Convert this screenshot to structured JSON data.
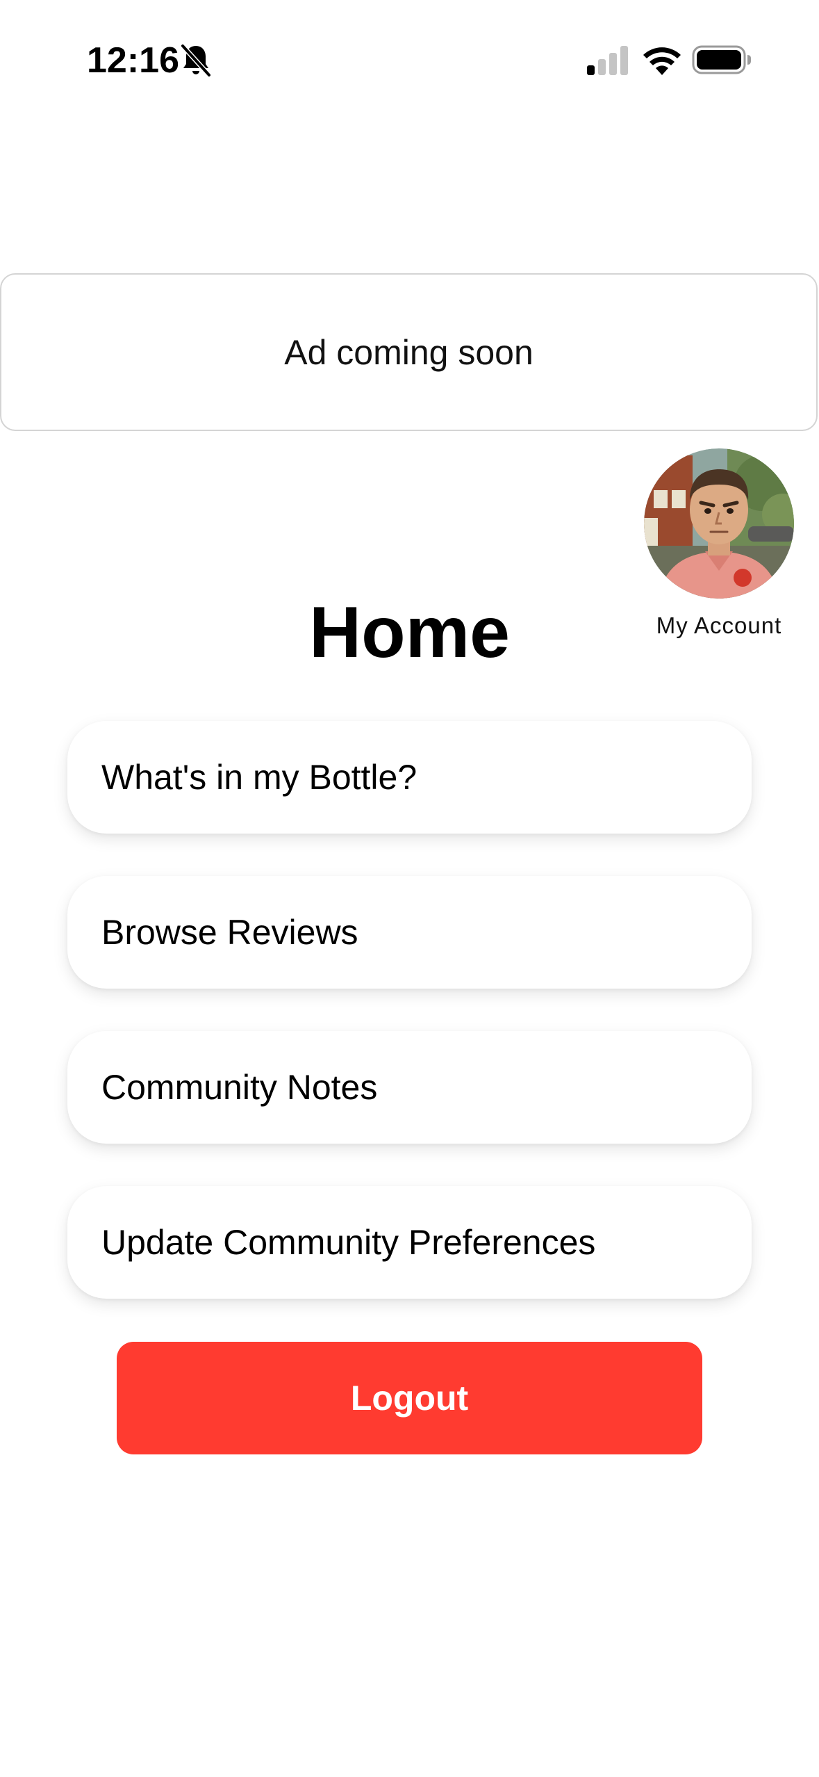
{
  "status_bar": {
    "time": "12:16",
    "icons": [
      "bell-slash-icon",
      "cellular-signal-icon",
      "wifi-icon",
      "battery-icon"
    ]
  },
  "ad": {
    "text": "Ad coming soon"
  },
  "account": {
    "label": "My Account",
    "avatar_icon": "avatar-image"
  },
  "page": {
    "title": "Home"
  },
  "menu": {
    "items": [
      {
        "label": "What's in my Bottle?"
      },
      {
        "label": "Browse Reviews"
      },
      {
        "label": "Community Notes"
      },
      {
        "label": "Update Community Preferences"
      }
    ]
  },
  "logout": {
    "label": "Logout"
  },
  "colors": {
    "accent_red": "#ff3b30",
    "background": "#ffffff",
    "border": "#d4d4d4"
  }
}
